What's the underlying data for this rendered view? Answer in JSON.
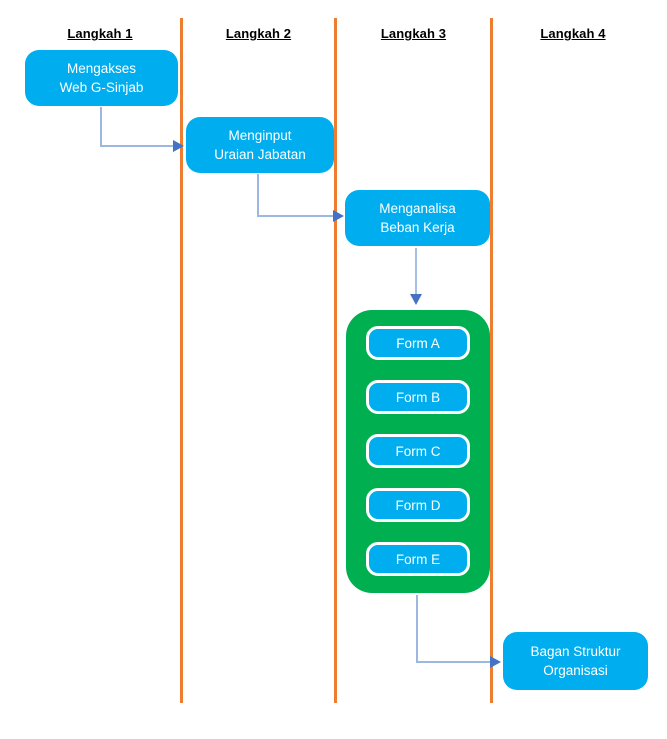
{
  "diagram": {
    "columns": [
      {
        "label": "Langkah 1"
      },
      {
        "label": "Langkah 2"
      },
      {
        "label": "Langkah 3"
      },
      {
        "label": "Langkah 4"
      }
    ],
    "nodes": [
      {
        "id": "access",
        "line1": "Mengakses",
        "line2": "Web G-Sinjab"
      },
      {
        "id": "input",
        "line1": "Menginput",
        "line2": "Uraian Jabatan"
      },
      {
        "id": "analyze",
        "line1": "Menganalisa",
        "line2": "Beban Kerja"
      },
      {
        "id": "output",
        "line1": "Bagan Struktur",
        "line2": "Organisasi"
      }
    ],
    "forms": [
      {
        "label": "Form A"
      },
      {
        "label": "Form B"
      },
      {
        "label": "Form C"
      },
      {
        "label": "Form D"
      },
      {
        "label": "Form E"
      }
    ],
    "colors": {
      "node_blue": "#00AEEF",
      "group_green": "#00B050",
      "divider_orange": "#ED7D31",
      "connector_blue": "#4472C4",
      "connector_line": "#9DB8E0",
      "text_white": "#FFFFFF",
      "header_black": "#000000"
    }
  }
}
